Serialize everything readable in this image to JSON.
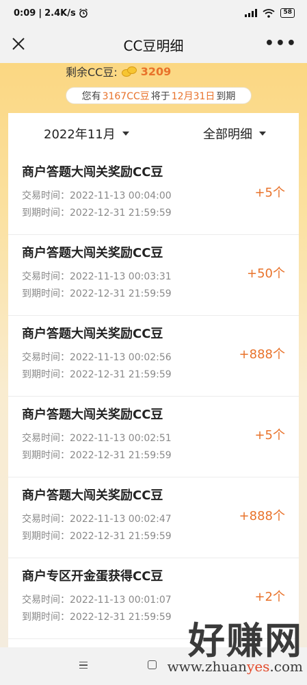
{
  "status": {
    "time": "0:09",
    "speed": "2.4K/s",
    "hd": "HD",
    "battery": "58"
  },
  "nav": {
    "title": "CC豆明细"
  },
  "summary": {
    "remain_label": "剩余CC豆:",
    "remain_value": "3209",
    "expire_prefix": "您有",
    "expire_amount": "3167CC豆",
    "expire_middle": "将于",
    "expire_date": "12月31日",
    "expire_suffix": "到期"
  },
  "filters": {
    "month": "2022年11月",
    "type": "全部明细"
  },
  "records": [
    {
      "title": "商户答题大闯关奖励CC豆",
      "time": "交易时间：2022-11-13 00:04:00",
      "expire": "到期时间：2022-12-31 21:59:59",
      "amount": "+5个"
    },
    {
      "title": "商户答题大闯关奖励CC豆",
      "time": "交易时间：2022-11-13 00:03:31",
      "expire": "到期时间：2022-12-31 21:59:59",
      "amount": "+50个"
    },
    {
      "title": "商户答题大闯关奖励CC豆",
      "time": "交易时间：2022-11-13 00:02:56",
      "expire": "到期时间：2022-12-31 21:59:59",
      "amount": "+888个"
    },
    {
      "title": "商户答题大闯关奖励CC豆",
      "time": "交易时间：2022-11-13 00:02:51",
      "expire": "到期时间：2022-12-31 21:59:59",
      "amount": "+5个"
    },
    {
      "title": "商户答题大闯关奖励CC豆",
      "time": "交易时间：2022-11-13 00:02:47",
      "expire": "到期时间：2022-12-31 21:59:59",
      "amount": "+888个"
    },
    {
      "title": "商户专区开金蛋获得CC豆",
      "time": "交易时间：2022-11-13 00:01:07",
      "expire": "到期时间：2022-12-31 21:59:59",
      "amount": "+2个"
    }
  ],
  "watermark": {
    "brand": "好赚网",
    "domain_a": "www.zhuan",
    "domain_b": "yes",
    "domain_c": ".com"
  },
  "colors": {
    "accent": "#e8722a",
    "header": "#fbd782"
  }
}
